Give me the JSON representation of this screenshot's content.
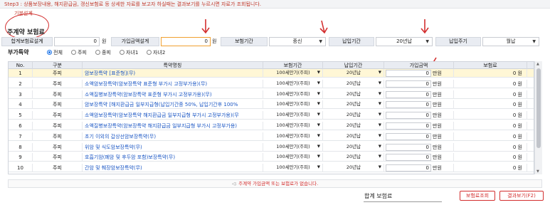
{
  "step_bar": {
    "text": "Step3 :  상품보장내용, 해지환급금, 갱신보험료 등 상세한 자료를 보고자 하실때는 결과보기를 누르시면 자료가 조회됩니다."
  },
  "section": {
    "basic_label": "기본설계",
    "main_title": "주계약 보험료"
  },
  "main_form": {
    "total_premium_label": "합계보험료설계",
    "total_premium_value": "0",
    "unit_won": "원",
    "insured_amount_label": "가입금액설계",
    "insured_amount_value": "0",
    "insurance_period_label": "보험기간",
    "insurance_period_value": "종신",
    "payment_period_label": "납입기간",
    "payment_period_value": "20년납",
    "payment_cycle_label": "납입주기",
    "payment_cycle_value": "월납"
  },
  "riders": {
    "title": "부가특약",
    "filters": [
      {
        "label": "전체",
        "checked": true
      },
      {
        "label": "주피",
        "checked": false
      },
      {
        "label": "종피",
        "checked": false
      },
      {
        "label": "자녀1",
        "checked": false
      },
      {
        "label": "자녀2",
        "checked": false
      }
    ]
  },
  "table": {
    "headers": [
      "No.",
      "구분",
      "특약명칭",
      "보험기간",
      "납입기간",
      "가입금액",
      "보험료"
    ],
    "rows": [
      {
        "no": "1",
        "type": "주피",
        "name": "암보장특약 [표준형](무)",
        "period": "100세만기(주피)",
        "pay": "20년납",
        "amount": "0",
        "unit": "만원",
        "premium": "0 원"
      },
      {
        "no": "2",
        "type": "주피",
        "name": "소액암보장특약(암보장특약 표준형 부가시 고정부가용)(무)",
        "period": "100세만기(주피)",
        "pay": "20년납",
        "amount": "0",
        "unit": "만원",
        "premium": "0 원"
      },
      {
        "no": "3",
        "type": "주피",
        "name": "소액질병보장특약(암보장특약 표준형 부가시 고정부가용)(무)",
        "period": "100세만기(주피)",
        "pay": "20년납",
        "amount": "0",
        "unit": "만원",
        "premium": "0 원"
      },
      {
        "no": "4",
        "type": "주피",
        "name": "암보장특약 [해지환급금 일부지급형(납입기간중 50%, 납입기간후 100%",
        "period": "100세만기(주피)",
        "pay": "20년납",
        "amount": "0",
        "unit": "만원",
        "premium": "0 원"
      },
      {
        "no": "5",
        "type": "주피",
        "name": "소액암보장특약(암보장특약 해지환급금 일부지급형 부가시 고정부가용)(무",
        "period": "100세만기(주피)",
        "pay": "20년납",
        "amount": "0",
        "unit": "만원",
        "premium": "0 원"
      },
      {
        "no": "6",
        "type": "주피",
        "name": "소액질병보장특약(암보장특약 해지환급금 일부지급형 부가시 고정부가용)",
        "period": "100세만기(주피)",
        "pay": "20년납",
        "amount": "0",
        "unit": "만원",
        "premium": "0 원"
      },
      {
        "no": "7",
        "type": "주피",
        "name": "초기 이외의 갑상선암보장특약(무)",
        "period": "100세만기(주피)",
        "pay": "20년납",
        "amount": "0",
        "unit": "만원",
        "premium": "0 원"
      },
      {
        "no": "8",
        "type": "주피",
        "name": "위암 및 식도암보장특약(무)",
        "period": "100세만기(주피)",
        "pay": "20년납",
        "amount": "0",
        "unit": "만원",
        "premium": "0 원"
      },
      {
        "no": "9",
        "type": "주피",
        "name": "호흡기암(폐암 및 후두암 포함)보장특약(무)",
        "period": "100세만기(주피)",
        "pay": "20년납",
        "amount": "0",
        "unit": "만원",
        "premium": "0 원"
      },
      {
        "no": "10",
        "type": "주피",
        "name": "간암 및 췌장암보장특약(무)",
        "period": "100세만기(주피)",
        "pay": "20년납",
        "amount": "0",
        "unit": "만원",
        "premium": "0 원"
      }
    ]
  },
  "footer": {
    "notice": "주계약 가입금액 또는 보험료가 없습니다.",
    "total_label": "합계 보험료",
    "premium_lookup_button": "보험료조회",
    "result_view_button": "결과보기(F2)"
  },
  "colors": {
    "accent_red": "#d32f2f",
    "link_blue": "#1a56c4",
    "header_bg": "#e9ecf2"
  }
}
